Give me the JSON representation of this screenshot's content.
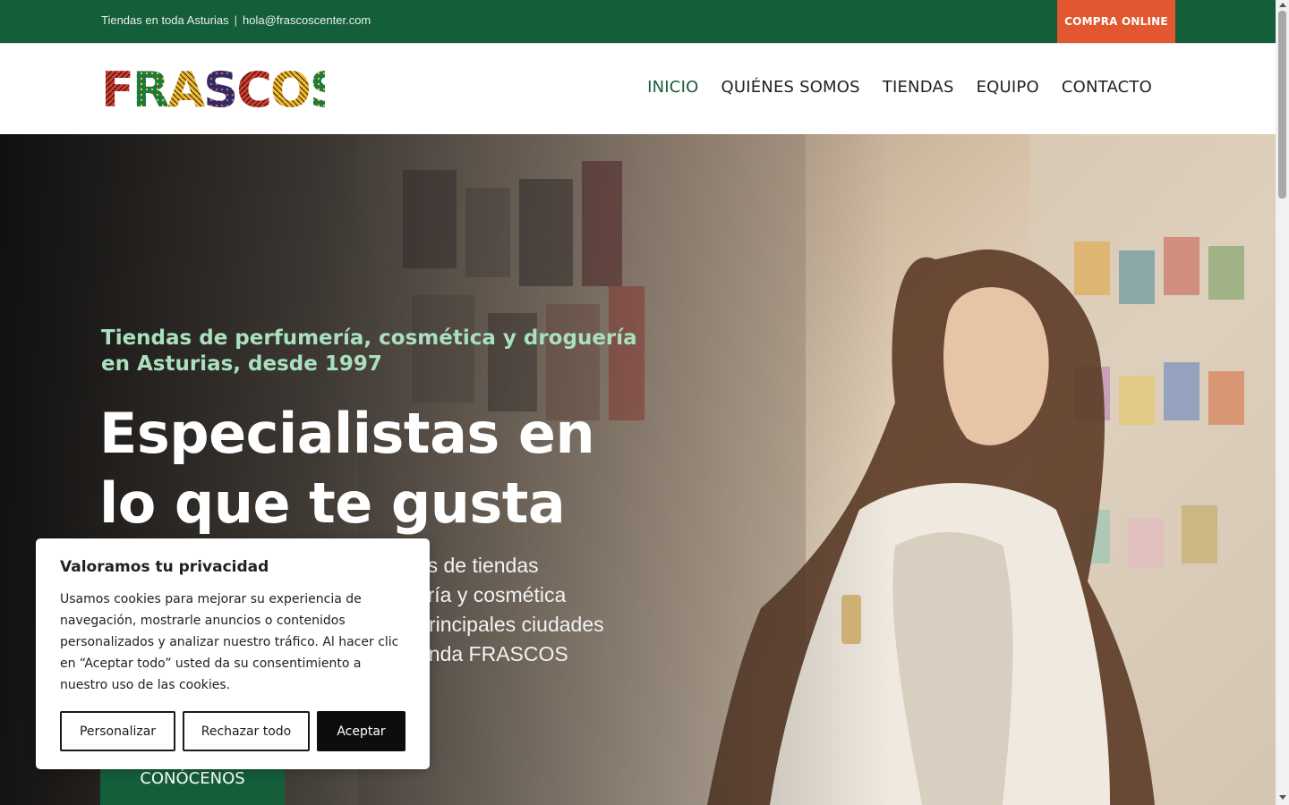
{
  "topbar": {
    "location": "Tiendas en toda Asturias",
    "separator": "|",
    "email": "hola@frascoscenter.com",
    "shop_button": "COMPRA ONLINE"
  },
  "header": {
    "logo_text": "FRASCOS",
    "nav": [
      "INICIO",
      "QUIÉNES SOMOS",
      "TIENDAS",
      "EQUIPO",
      "CONTACTO"
    ],
    "active": "INICIO"
  },
  "hero": {
    "subtitle": "Tiendas de perfumería, cosmética y droguería en Asturias, desde 1997",
    "title_line1": "Especialistas en",
    "title_line2": "lo que te gusta",
    "description_visible": [
      "des de tiendas",
      "uería y cosmética",
      "rincipales ciudades",
      "enda FRASCOS"
    ],
    "cta": "CONÓCENOS"
  },
  "cookie": {
    "title": "Valoramos tu privacidad",
    "text": "Usamos cookies para mejorar su experiencia de navegación, mostrarle anuncios o contenidos personalizados y analizar nuestro tráfico. Al hacer clic en “Aceptar todo” usted da su consentimiento a nuestro uso de las cookies.",
    "btn_customize": "Personalizar",
    "btn_reject": "Rechazar todo",
    "btn_accept": "Aceptar"
  },
  "colors": {
    "brand_green": "#155e3a",
    "accent_orange": "#e2572f",
    "subtitle_green": "#a9e0bd"
  }
}
